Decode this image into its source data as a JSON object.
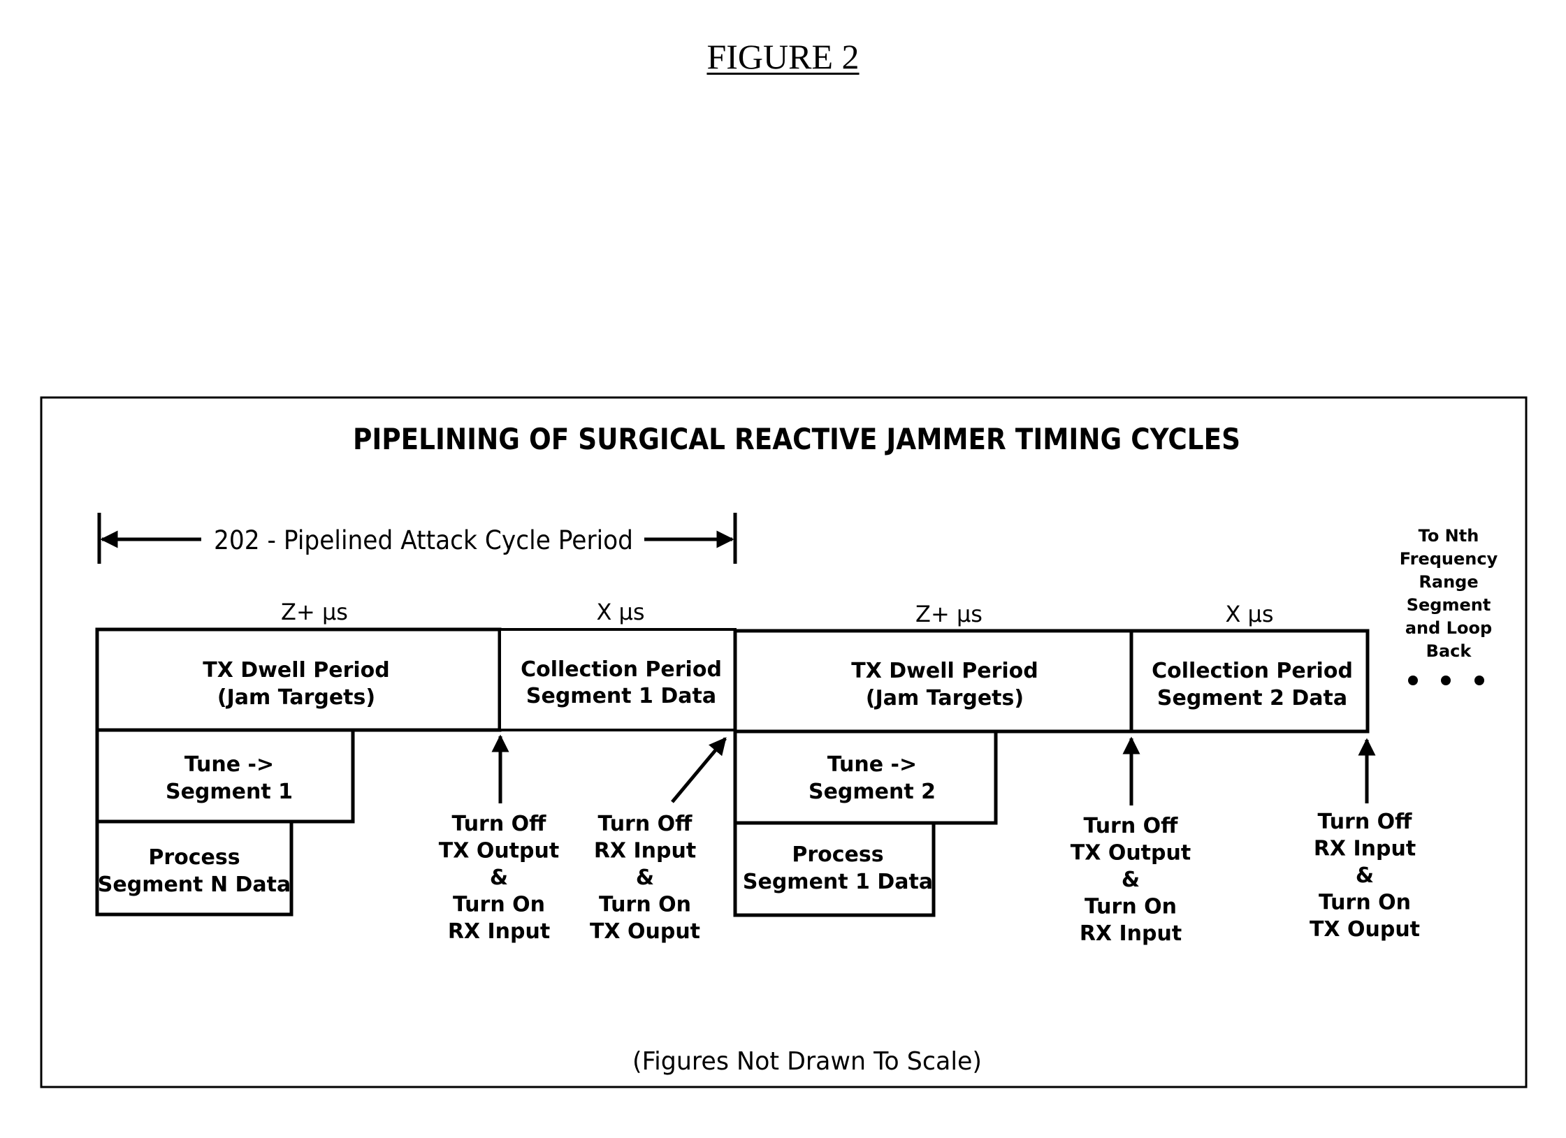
{
  "figure_label": "FIGURE 2",
  "diagram": {
    "title": "PIPELINING OF SURGICAL REACTIVE JAMMER TIMING CYCLES",
    "cycle_period_label": "202 - Pipelined Attack Cycle Period",
    "footer_note": "(Figures Not Drawn To Scale)",
    "timeline_segments": [
      {
        "duration_label": "Z+ µs",
        "lines": [
          "TX Dwell Period",
          "(Jam Targets)"
        ]
      },
      {
        "duration_label": "X µs",
        "lines": [
          "Collection Period",
          "Segment 1 Data"
        ]
      },
      {
        "duration_label": "Z+ µs",
        "lines": [
          "TX Dwell Period",
          "(Jam Targets)"
        ]
      },
      {
        "duration_label": "X µs",
        "lines": [
          "Collection Period",
          "Segment 2 Data"
        ]
      }
    ],
    "sub_boxes": [
      {
        "name": "tune-segment-1",
        "lines": [
          "Tune ->",
          "Segment 1"
        ]
      },
      {
        "name": "process-segment-n",
        "lines": [
          "Process",
          "Segment N Data"
        ]
      },
      {
        "name": "tune-segment-2",
        "lines": [
          "Tune ->",
          "Segment 2"
        ]
      },
      {
        "name": "process-segment-1",
        "lines": [
          "Process",
          "Segment 1 Data"
        ]
      }
    ],
    "events": [
      {
        "lines": [
          "Turn Off",
          "TX Output",
          "&",
          "Turn On",
          "RX Input"
        ]
      },
      {
        "lines": [
          "Turn Off",
          "RX Input",
          "&",
          "Turn On",
          "TX Ouput"
        ]
      },
      {
        "lines": [
          "Turn Off",
          "TX Output",
          "&",
          "Turn On",
          "RX Input"
        ]
      },
      {
        "lines": [
          "Turn Off",
          "RX Input",
          "&",
          "Turn On",
          "TX Ouput"
        ]
      }
    ],
    "continuation": {
      "lines": [
        "To Nth",
        "Frequency",
        "Range",
        "Segment",
        "and Loop",
        "Back"
      ],
      "ellipsis": "• • •"
    }
  }
}
